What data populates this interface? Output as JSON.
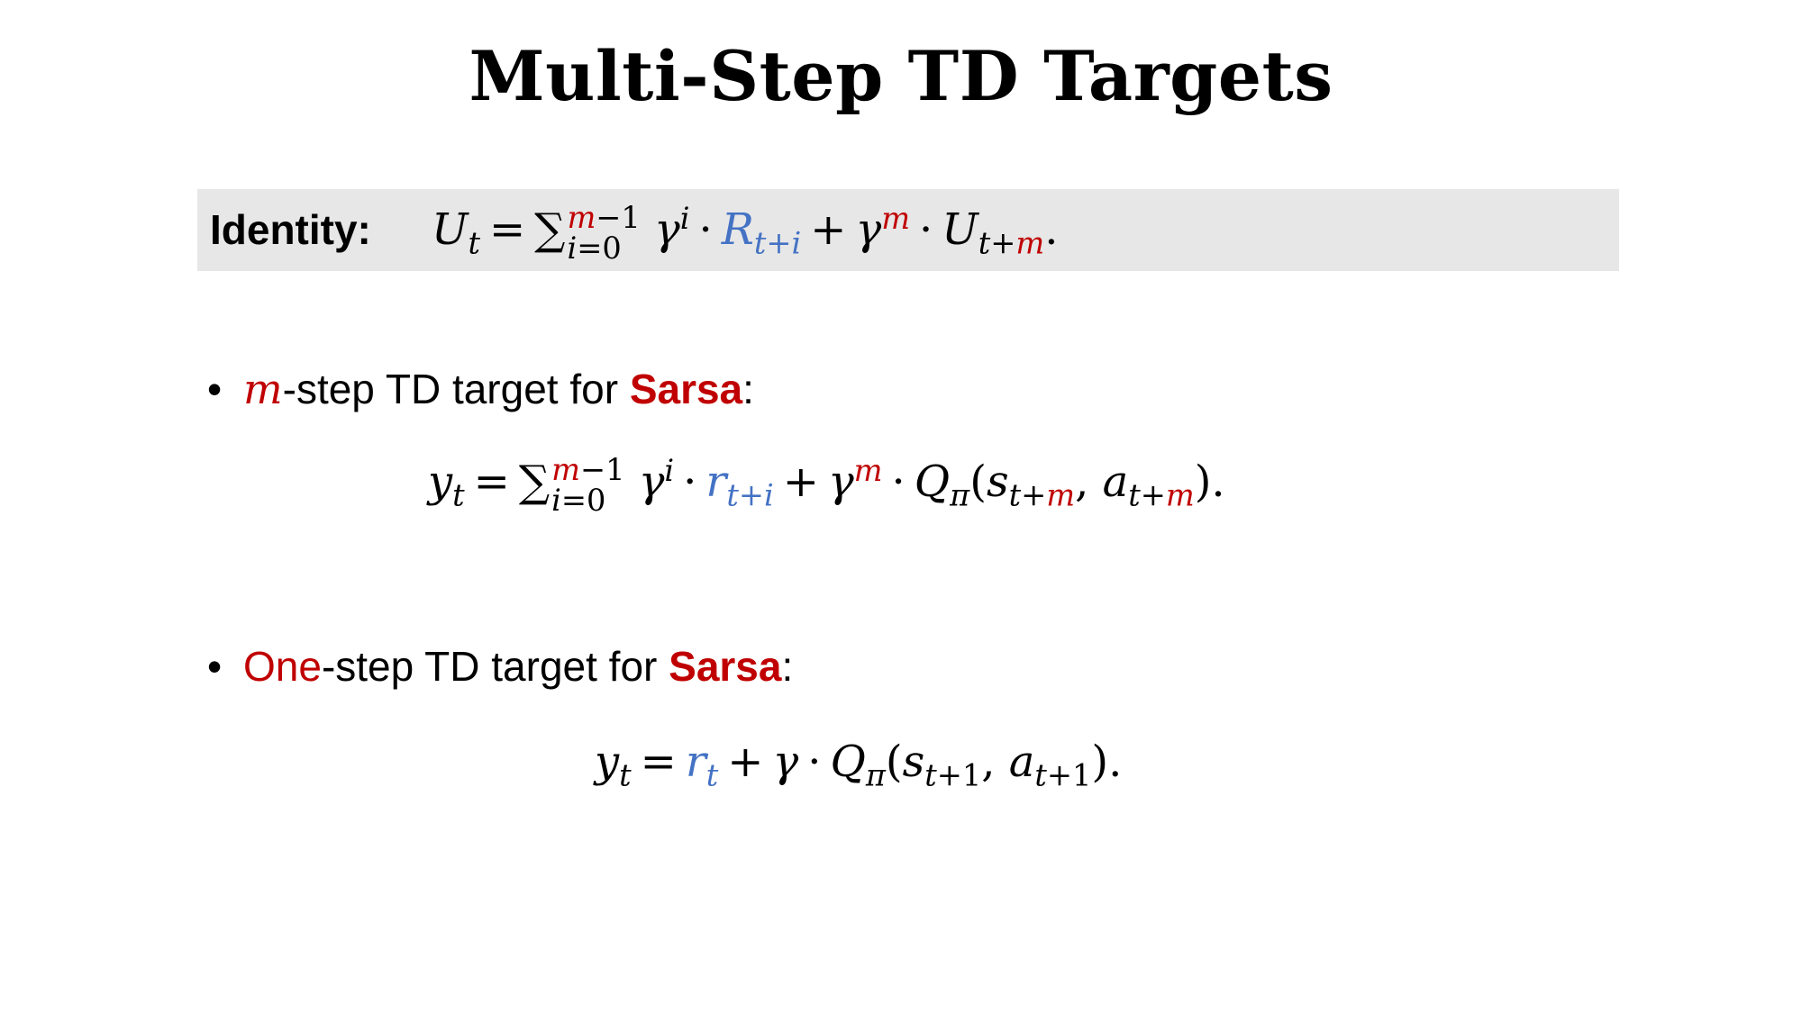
{
  "slide": {
    "title": "Multi-Step TD Targets"
  },
  "identity": {
    "label": "Identity:"
  },
  "bullets": [
    {
      "highlight": "m",
      "text": "-step TD target for ",
      "method": "Sarsa",
      "colon": ":"
    },
    {
      "highlight": "One",
      "text": "-step TD target for ",
      "method": "Sarsa",
      "colon": ":"
    }
  ],
  "colors": {
    "accent_red": "#c00000",
    "accent_blue": "#4472c4",
    "identity_box": "#e7e7e7"
  }
}
